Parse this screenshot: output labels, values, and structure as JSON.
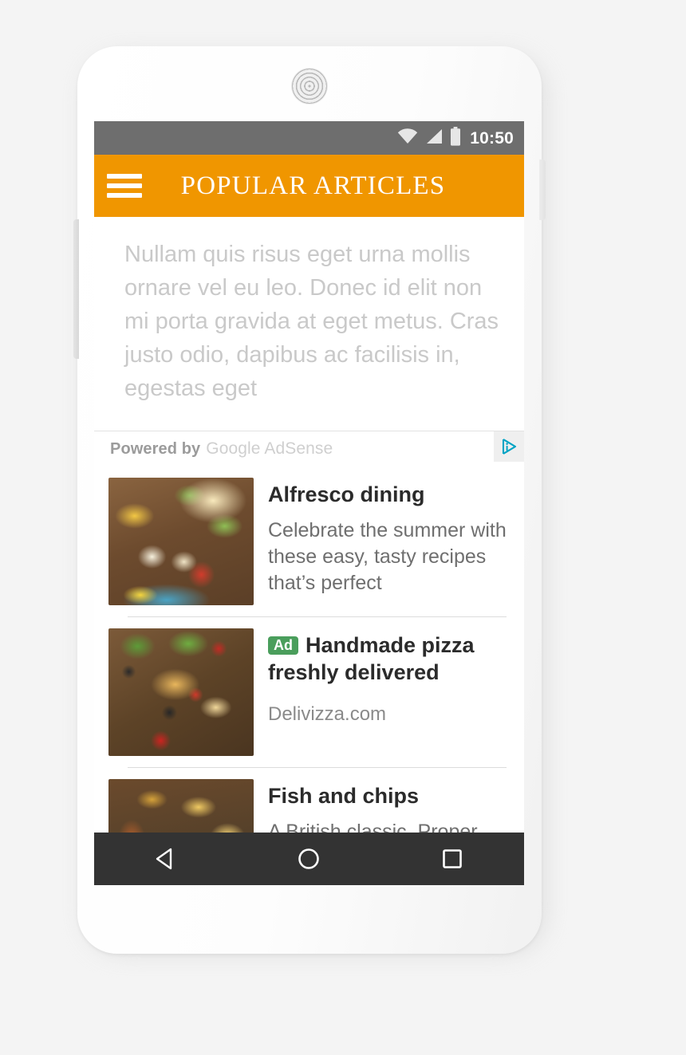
{
  "device": {
    "speaker_icon": "speaker-grille",
    "volume_button": "volume-rocker",
    "power_button": "power-button"
  },
  "status_bar": {
    "time": "10:50",
    "icons": [
      "wifi-icon",
      "cell-signal-icon",
      "battery-icon"
    ],
    "background": "#6e6e6e"
  },
  "app_bar": {
    "menu_icon": "hamburger-menu-icon",
    "title": "POPULAR ARTICLES",
    "background": "#f09600",
    "text_color": "#ffffff"
  },
  "article": {
    "body": "Nullam quis risus eget urna mollis ornare vel eu leo. Donec id elit non mi porta gravida at eget metus. Cras justo odio, dapibus ac facilisis in, egestas eget"
  },
  "ad_unit": {
    "powered_by_label": "Powered by",
    "brand_label": "Google AdSense",
    "adchoices_icon": "adchoices-icon",
    "adchoices_color": "#00a3c4",
    "ads": [
      {
        "badge": "",
        "title": "Alfresco dining",
        "description": "Celebrate the summer with these easy, tasty recipes that’s perfect",
        "url": "",
        "thumbnail": "alfresco-dining-thumbnail"
      },
      {
        "badge": "Ad",
        "title": "Handmade pizza freshly delivered",
        "description": "",
        "url": "Delivizza.com",
        "thumbnail": "handmade-pizza-thumbnail"
      },
      {
        "badge": "",
        "title": "Fish and chips",
        "description": "A British classic. Proper",
        "url": "",
        "thumbnail": "fish-and-chips-thumbnail"
      }
    ],
    "badge_color": "#4a9e5c"
  },
  "nav_bar": {
    "background": "#333333",
    "buttons": [
      {
        "name": "back-button",
        "icon": "back-triangle-icon"
      },
      {
        "name": "home-button",
        "icon": "home-circle-icon"
      },
      {
        "name": "recents-button",
        "icon": "recents-square-icon"
      }
    ]
  }
}
